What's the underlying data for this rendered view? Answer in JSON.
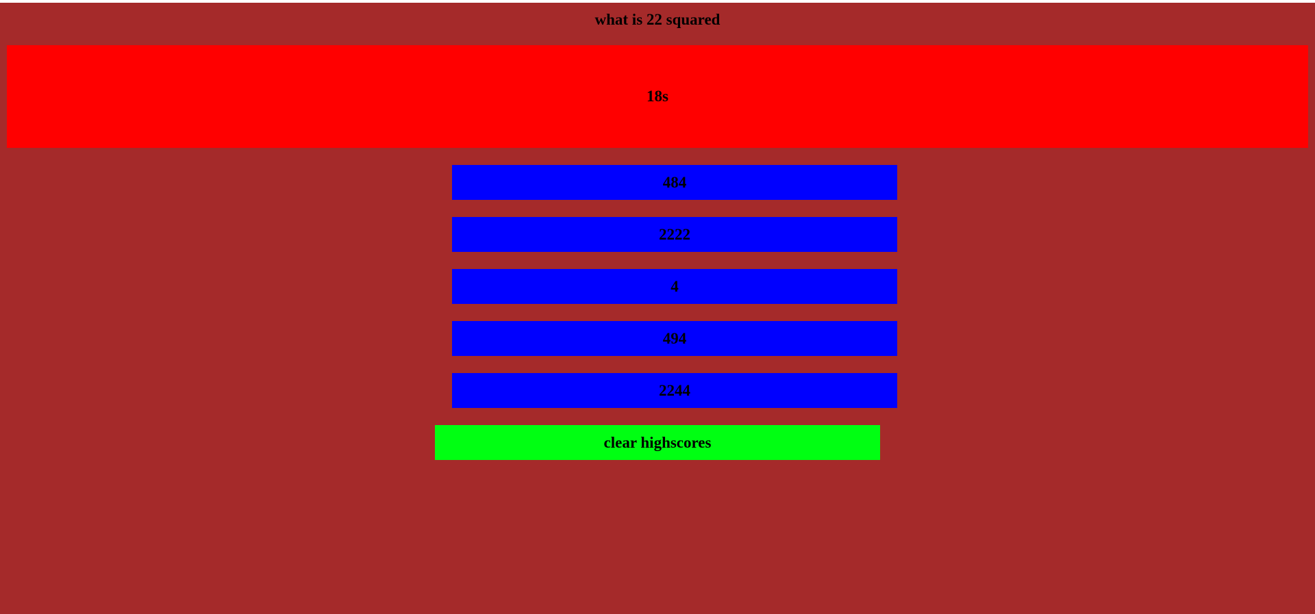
{
  "question": {
    "text": "what is 22 squared"
  },
  "timer": {
    "label": "18s"
  },
  "answers": [
    {
      "label": "484"
    },
    {
      "label": "2222"
    },
    {
      "label": "4"
    },
    {
      "label": "494"
    },
    {
      "label": "2244"
    }
  ],
  "controls": {
    "clear_label": "clear highscores"
  },
  "colors": {
    "background": "#a52a2a",
    "timer": "#ff0000",
    "answer": "#0000ff",
    "clear": "#00ff12"
  }
}
